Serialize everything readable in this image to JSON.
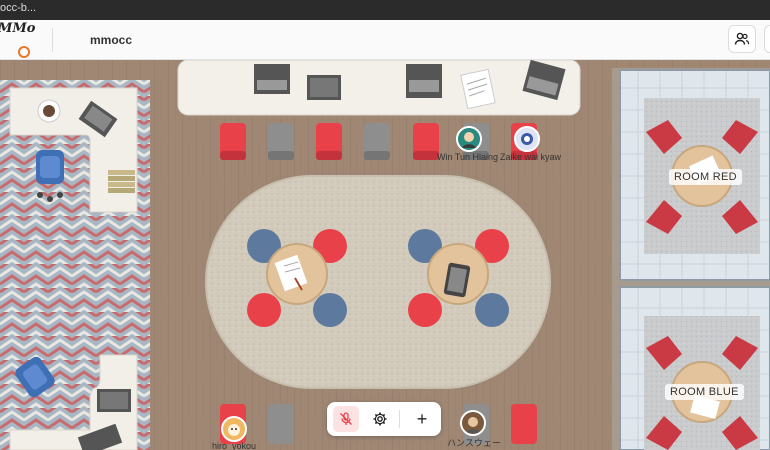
{
  "browser": {
    "tab_title": "occ-b..."
  },
  "header": {
    "logo_text": "MMo",
    "app_name": "mmocc",
    "icons": {
      "users": "users-icon",
      "extra": "menu-icon"
    }
  },
  "rooms": [
    {
      "label": "ROOM RED"
    },
    {
      "label": "ROOM BLUE"
    }
  ],
  "users": [
    {
      "name": "Win Tun Hlaing"
    },
    {
      "name": "Zaike wai kyaw"
    },
    {
      "name": "hiro_yokou"
    },
    {
      "name": "ハンスウェー"
    }
  ],
  "toolbar": {
    "mic": "mic-off-icon",
    "settings": "gear-icon",
    "add": "plus-icon",
    "add_label": "+"
  },
  "colors": {
    "accent_red": "#e8414a",
    "seat_gray": "#8e8e8e",
    "seat_blue": "#5d7a9e",
    "logo_orange": "#e9762b"
  }
}
